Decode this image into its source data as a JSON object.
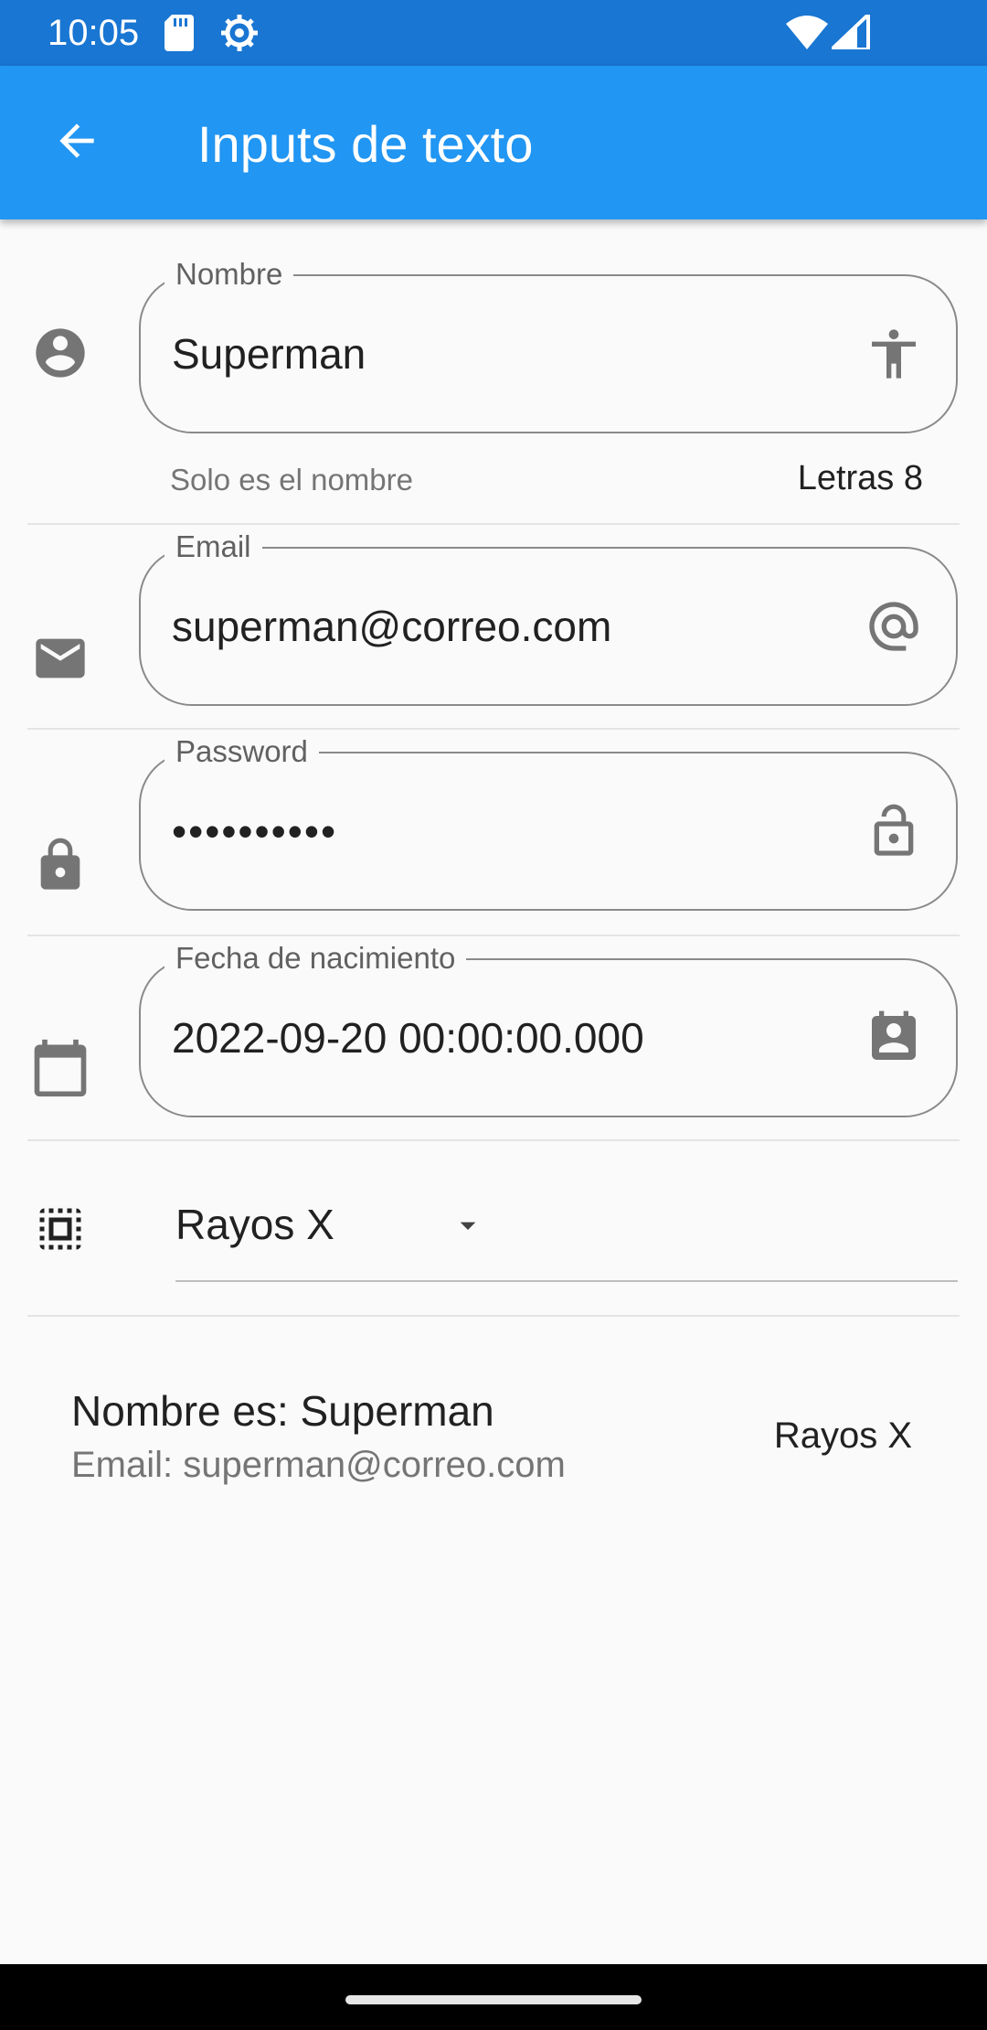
{
  "status_bar": {
    "time": "10:05",
    "icons": [
      "sd-card-icon",
      "gear-icon",
      "wifi-icon",
      "signal-icon"
    ]
  },
  "app_bar": {
    "title": "Inputs de texto",
    "back_icon": "arrow-back-icon",
    "color": "#2196f3"
  },
  "form": {
    "name": {
      "label": "Nombre",
      "value": "Superman",
      "helper": "Solo es el nombre",
      "counter": "Letras 8",
      "leading_icon": "account-circle-icon",
      "trailing_icon": "accessibility-icon"
    },
    "email": {
      "label": "Email",
      "value": "superman@correo.com",
      "leading_icon": "mail-icon",
      "trailing_icon": "alternate-email-icon"
    },
    "password": {
      "label": "Password",
      "value": "••••••••••",
      "leading_icon": "lock-icon",
      "trailing_icon": "lock-open-icon"
    },
    "birthdate": {
      "label": "Fecha de nacimiento",
      "value": "2022-09-20 00:00:00.000",
      "leading_icon": "calendar-icon",
      "trailing_icon": "contact-calendar-icon"
    },
    "power": {
      "selected": "Rayos X",
      "leading_icon": "select-all-icon"
    }
  },
  "summary": {
    "title": "Nombre es: Superman",
    "subtitle": "Email: superman@correo.com",
    "trailing": "Rayos X"
  }
}
